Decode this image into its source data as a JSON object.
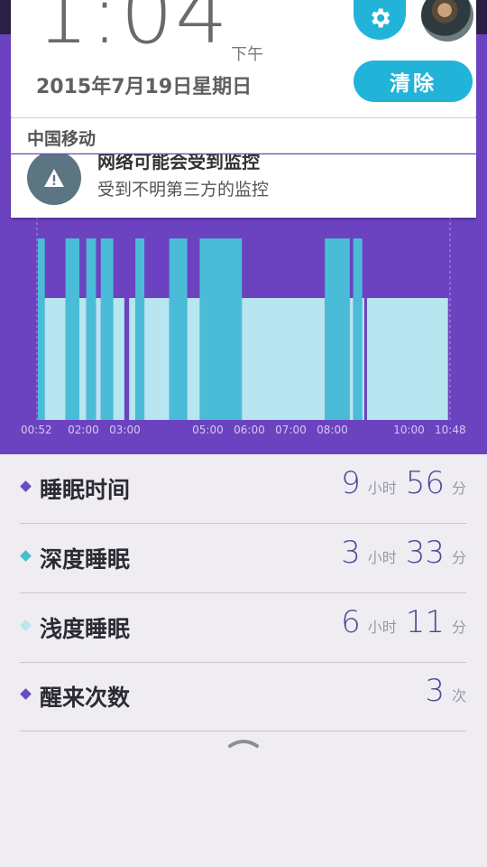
{
  "status": {
    "time": "1:04",
    "ampm": "下午",
    "date": "2015年7月19日星期日",
    "clear_label": "清除",
    "carrier": "中国移动"
  },
  "notification": {
    "title": "网络可能会受到监控",
    "subtitle": "受到不明第三方的监控"
  },
  "colors": {
    "chart_bg": "#6b43c0",
    "deep_sleep": "#4bbcd8",
    "light_sleep": "#b7e6f0",
    "awake": "#6b43c0",
    "accent": "#22b3d9"
  },
  "chart_data": {
    "type": "timeline",
    "x_ticks": [
      "00:52",
      "02:00",
      "03:00",
      "05:00",
      "06:00",
      "07:00",
      "08:00",
      "10:00",
      "10:48"
    ],
    "start": "00:52",
    "end": "10:48",
    "segments": [
      {
        "from": "00:52",
        "to": "01:02",
        "state": "deep"
      },
      {
        "from": "01:02",
        "to": "01:32",
        "state": "light"
      },
      {
        "from": "01:32",
        "to": "01:52",
        "state": "deep"
      },
      {
        "from": "01:52",
        "to": "02:02",
        "state": "light"
      },
      {
        "from": "02:02",
        "to": "02:16",
        "state": "deep"
      },
      {
        "from": "02:16",
        "to": "02:23",
        "state": "light"
      },
      {
        "from": "02:23",
        "to": "02:41",
        "state": "deep"
      },
      {
        "from": "02:41",
        "to": "02:57",
        "state": "light"
      },
      {
        "from": "02:57",
        "to": "03:04",
        "state": "awake"
      },
      {
        "from": "03:04",
        "to": "03:13",
        "state": "light"
      },
      {
        "from": "03:13",
        "to": "03:26",
        "state": "deep"
      },
      {
        "from": "03:26",
        "to": "04:02",
        "state": "light"
      },
      {
        "from": "04:02",
        "to": "04:28",
        "state": "deep"
      },
      {
        "from": "04:28",
        "to": "04:46",
        "state": "light"
      },
      {
        "from": "04:46",
        "to": "05:47",
        "state": "deep"
      },
      {
        "from": "05:47",
        "to": "07:47",
        "state": "light"
      },
      {
        "from": "07:47",
        "to": "08:23",
        "state": "deep"
      },
      {
        "from": "08:23",
        "to": "08:28",
        "state": "light"
      },
      {
        "from": "08:28",
        "to": "08:41",
        "state": "deep"
      },
      {
        "from": "08:41",
        "to": "08:44",
        "state": "light"
      },
      {
        "from": "08:44",
        "to": "08:48",
        "state": "awake"
      },
      {
        "from": "08:48",
        "to": "10:45",
        "state": "light"
      }
    ]
  },
  "stats": [
    {
      "label": "睡眠时间",
      "dot_color": "#6a4bc4",
      "parts": [
        {
          "num": "9",
          "unit": "小时"
        },
        {
          "num": "56",
          "unit": "分"
        }
      ]
    },
    {
      "label": "深度睡眠",
      "dot_color": "#3fc1cf",
      "parts": [
        {
          "num": "3",
          "unit": "小时"
        },
        {
          "num": "33",
          "unit": "分"
        }
      ]
    },
    {
      "label": "浅度睡眠",
      "dot_color": "#b7e6f0",
      "parts": [
        {
          "num": "6",
          "unit": "小时"
        },
        {
          "num": "11",
          "unit": "分"
        }
      ]
    },
    {
      "label": "醒来次数",
      "dot_color": "#6a4bc4",
      "parts": [
        {
          "num": "3",
          "unit": "次"
        }
      ]
    }
  ]
}
